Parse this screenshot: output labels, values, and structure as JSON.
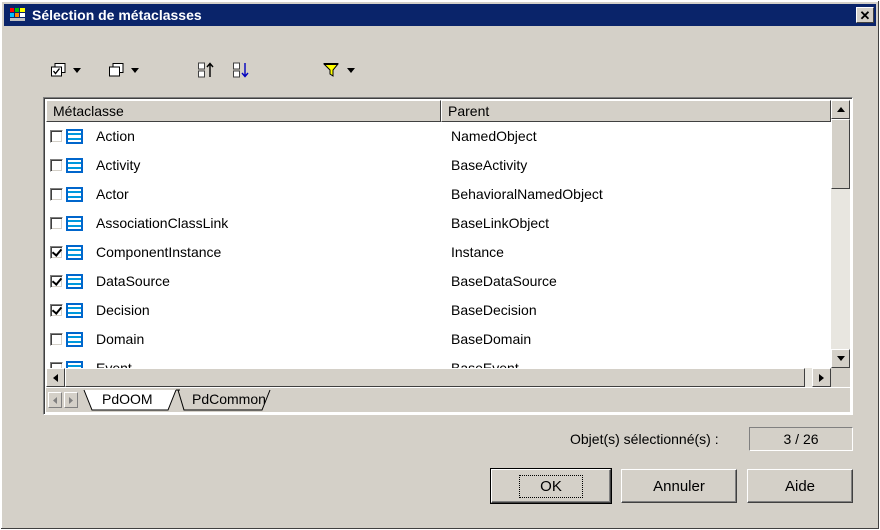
{
  "window": {
    "title": "Sélection de métaclasses",
    "close_glyph": "✕"
  },
  "toolbar": {
    "buttons": [
      {
        "icon": "select-all-icon",
        "has_dropdown": true
      },
      {
        "icon": "deselect-all-icon",
        "has_dropdown": true
      },
      {
        "icon": "move-to-top-icon",
        "has_dropdown": false
      },
      {
        "icon": "move-to-bottom-icon",
        "has_dropdown": false
      },
      {
        "icon": "filter-icon",
        "has_dropdown": true
      }
    ]
  },
  "list": {
    "columns": [
      "Métaclasse",
      "Parent"
    ],
    "rows": [
      {
        "name": "Action",
        "parent": "NamedObject",
        "checked": false
      },
      {
        "name": "Activity",
        "parent": "BaseActivity",
        "checked": false
      },
      {
        "name": "Actor",
        "parent": "BehavioralNamedObject",
        "checked": false
      },
      {
        "name": "AssociationClassLink",
        "parent": "BaseLinkObject",
        "checked": false
      },
      {
        "name": "ComponentInstance",
        "parent": "Instance",
        "checked": true
      },
      {
        "name": "DataSource",
        "parent": "BaseDataSource",
        "checked": true
      },
      {
        "name": "Decision",
        "parent": "BaseDecision",
        "checked": true
      },
      {
        "name": "Domain",
        "parent": "BaseDomain",
        "checked": false
      },
      {
        "name": "Event",
        "parent": "BaseEvent",
        "checked": false
      }
    ]
  },
  "tabs": [
    {
      "label": "PdOOM",
      "active": true
    },
    {
      "label": "PdCommon",
      "active": false
    }
  ],
  "status": {
    "label": "Objet(s) sélectionné(s) :",
    "value": "3 / 26"
  },
  "buttons": {
    "ok": "OK",
    "cancel": "Annuler",
    "help": "Aide"
  },
  "colors": {
    "titlebar": "#0a246a",
    "class_icon": "#0066cc"
  }
}
